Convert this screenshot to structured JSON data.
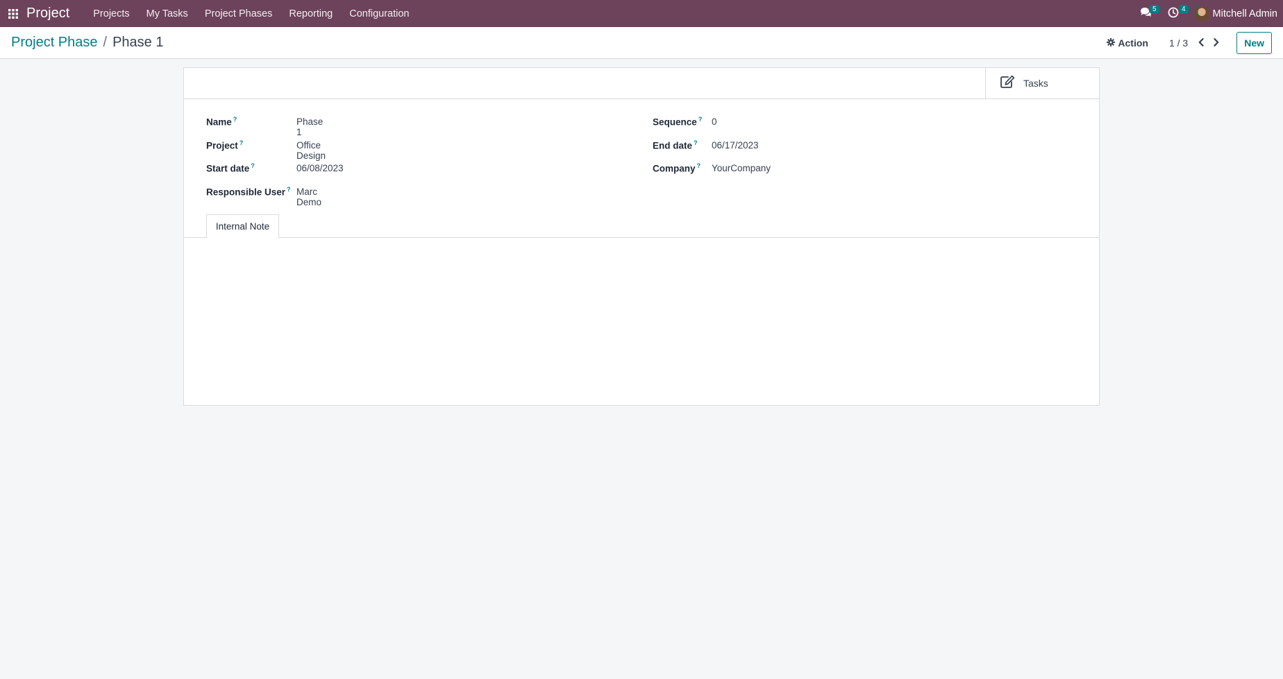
{
  "navbar": {
    "app_name": "Project",
    "menu": [
      "Projects",
      "My Tasks",
      "Project Phases",
      "Reporting",
      "Configuration"
    ],
    "messages_count": "5",
    "activities_count": "4",
    "user_name": "Mitchell Admin"
  },
  "control_panel": {
    "breadcrumb_parent": "Project Phase",
    "breadcrumb_separator": "/",
    "breadcrumb_current": "Phase 1",
    "action_label": "Action",
    "pager_value": "1 / 3",
    "new_label": "New"
  },
  "form": {
    "smart_button_tasks": "Tasks",
    "fields": {
      "name": {
        "label": "Name",
        "value": "Phase 1"
      },
      "project": {
        "label": "Project",
        "value": "Office Design"
      },
      "start_date": {
        "label": "Start date",
        "value": "06/08/2023"
      },
      "responsible_user": {
        "label": "Responsible User",
        "value": "Marc Demo"
      },
      "sequence": {
        "label": "Sequence",
        "value": "0"
      },
      "end_date": {
        "label": "End date",
        "value": "06/17/2023"
      },
      "company": {
        "label": "Company",
        "value": "YourCompany"
      }
    },
    "help_mark": "?",
    "tabs": [
      "Internal Note"
    ]
  },
  "colors": {
    "navbar": "#6d425b",
    "accent": "#017e84",
    "background": "#f5f6f8"
  },
  "icons": {
    "apps": "apps-grid-icon",
    "messages": "chat-bubbles-icon",
    "activities": "clock-icon",
    "action": "gear-icon",
    "pager_prev": "chevron-left-icon",
    "pager_next": "chevron-right-icon",
    "tasks": "edit-square-icon"
  }
}
